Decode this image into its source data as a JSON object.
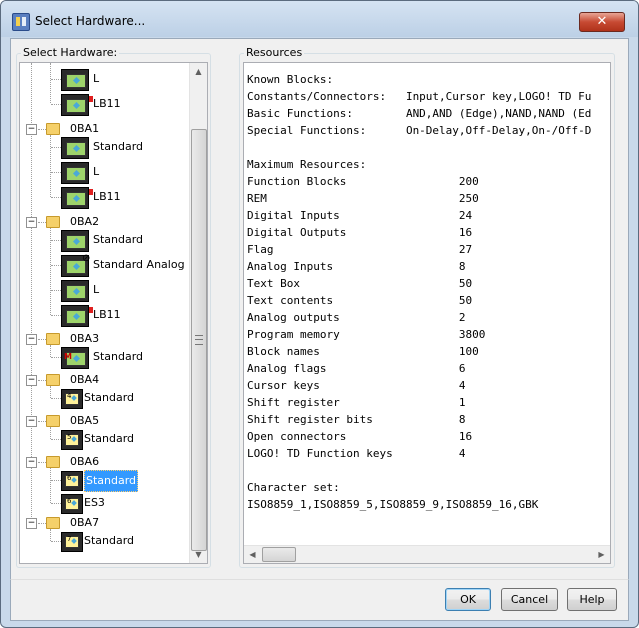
{
  "window": {
    "title": "Select Hardware...",
    "close_label": "✕"
  },
  "left_panel": {
    "title": "Select Hardware:",
    "tree": [
      {
        "label": "L"
      },
      {
        "label": "LB11"
      },
      {
        "label": "0BA1",
        "children": [
          "Standard",
          "L",
          "LB11"
        ]
      },
      {
        "label": "0BA2",
        "children": [
          "Standard",
          "Standard Analog",
          "L",
          "LB11"
        ]
      },
      {
        "label": "0BA3",
        "children": [
          "Standard"
        ]
      },
      {
        "label": "0BA4",
        "children": [
          "Standard"
        ]
      },
      {
        "label": "0BA5",
        "children": [
          "Standard"
        ]
      },
      {
        "label": "0BA6",
        "children": [
          "Standard",
          "ES3"
        ]
      },
      {
        "label": "0BA7",
        "children": [
          "Standard"
        ]
      }
    ],
    "icon_digits": {
      "0BA4": "4",
      "0BA5": "5",
      "0BA6": "6",
      "0BA7": "7",
      "0BA3": "M"
    }
  },
  "right_panel": {
    "title": "Resources",
    "lines": [
      "Known Blocks:",
      "Constants/Connectors:   Input,Cursor key,LOGO! TD Fu",
      "Basic Functions:        AND,AND (Edge),NAND,NAND (Ed",
      "Special Functions:      On-Delay,Off-Delay,On-/Off-D",
      "",
      "Maximum Resources:",
      "Function Blocks                 200",
      "REM                             250",
      "Digital Inputs                  24",
      "Digital Outputs                 16",
      "Flag                            27",
      "Analog Inputs                   8",
      "Text Box                        50",
      "Text contents                   50",
      "Analog outputs                  2",
      "Program memory                  3800",
      "Block names                     100",
      "Analog flags                    6",
      "Cursor keys                     4",
      "Shift register                  1",
      "Shift register bits             8",
      "Open connectors                 16",
      "LOGO! TD Function keys          4",
      "",
      "Character set:",
      "ISO8859_1,ISO8859_5,ISO8859_9,ISO8859_16,GBK"
    ]
  },
  "buttons": {
    "ok": "OK",
    "cancel": "Cancel",
    "help": "Help"
  }
}
